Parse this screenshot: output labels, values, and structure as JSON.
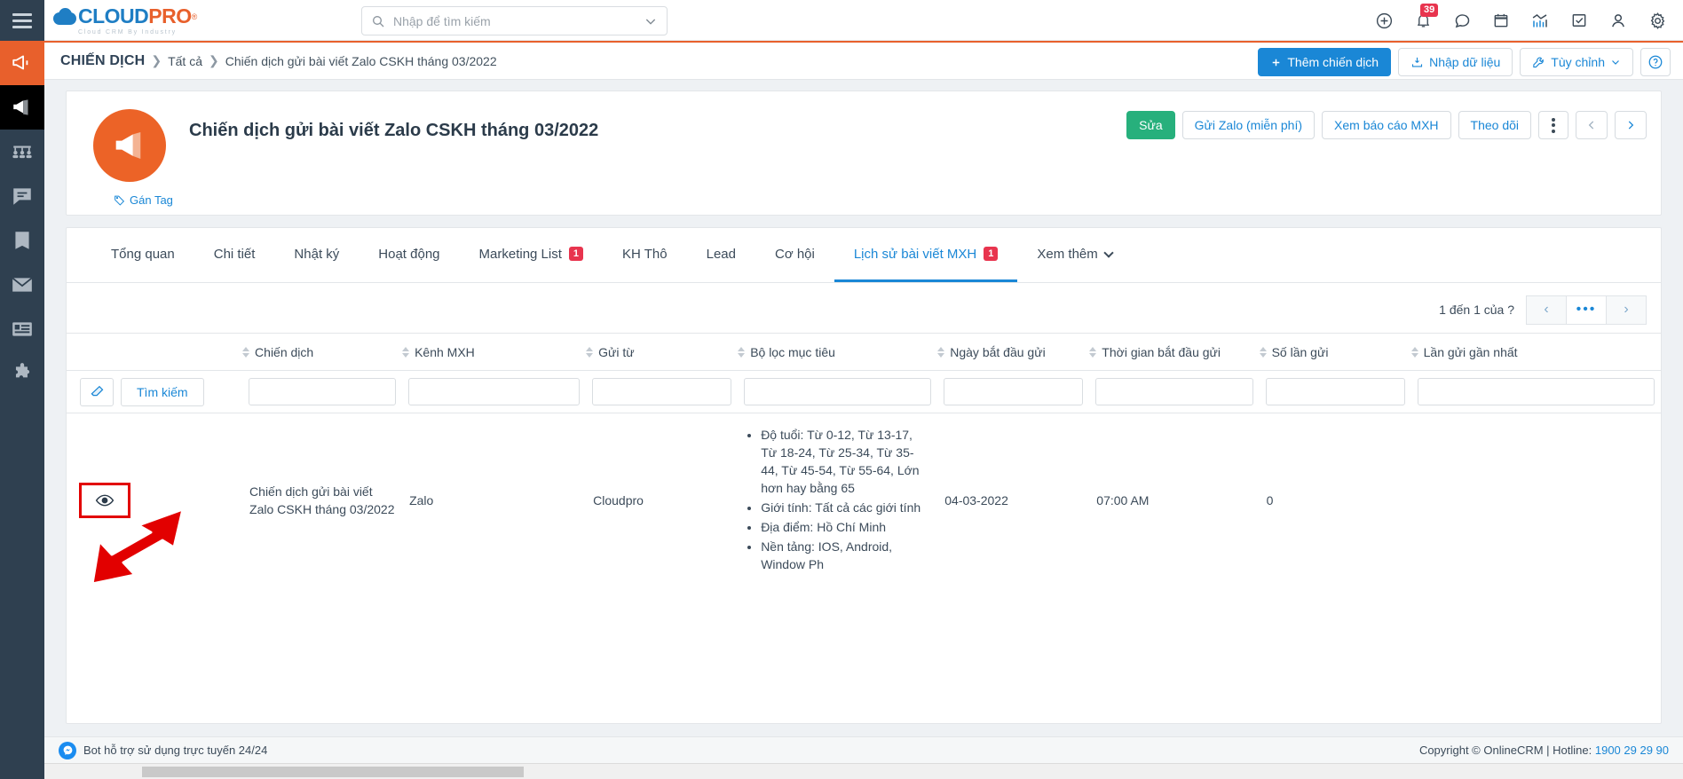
{
  "app": {
    "logo_cloud": "CLOUD",
    "logo_pro": "PRO",
    "logo_reg": "®",
    "logo_tagline": "Cloud CRM By Industry"
  },
  "search": {
    "placeholder": "Nhập để tìm kiếm",
    "value": "",
    "icon": "search-icon",
    "dropdown_icon": "chevron-down-icon"
  },
  "topbar_icons": [
    {
      "name": "add-circle-icon",
      "label": ""
    },
    {
      "name": "bell-icon",
      "label": "",
      "badge": "39"
    },
    {
      "name": "chat-bubble-icon",
      "label": ""
    },
    {
      "name": "calendar-icon",
      "label": ""
    },
    {
      "name": "analytics-chart-icon",
      "label": ""
    },
    {
      "name": "task-checkbox-icon",
      "label": ""
    },
    {
      "name": "user-account-icon",
      "label": ""
    },
    {
      "name": "settings-gear-icon",
      "label": ""
    }
  ],
  "sidebar": {
    "items": [
      {
        "name": "sidebar-item-campaign-active",
        "icon": "megaphone-icon",
        "state": "active"
      },
      {
        "name": "sidebar-item-campaign",
        "icon": "megaphone-icon",
        "state": "dark"
      },
      {
        "name": "sidebar-item-customers",
        "icon": "group-people-icon",
        "state": "normal"
      },
      {
        "name": "sidebar-item-chat",
        "icon": "chat-lines-icon",
        "state": "normal"
      },
      {
        "name": "sidebar-item-library",
        "icon": "book-icon",
        "state": "normal"
      },
      {
        "name": "sidebar-item-mail",
        "icon": "envelope-icon",
        "state": "normal"
      },
      {
        "name": "sidebar-item-news",
        "icon": "newspaper-icon",
        "state": "normal"
      },
      {
        "name": "sidebar-item-addons",
        "icon": "puzzle-piece-icon",
        "state": "normal"
      }
    ]
  },
  "breadcrumb": {
    "root": "CHIẾN DỊCH",
    "sep": "❯",
    "level1": "Tất cả",
    "level2": "Chiến dịch gửi bài viết Zalo CSKH tháng 03/2022"
  },
  "crumb_actions": {
    "add_campaign": "Thêm chiến dịch",
    "import_data": "Nhập dữ liệu",
    "customize": "Tùy chỉnh",
    "help_icon": "question-circle-icon",
    "add_icon": "plus-icon",
    "import_icon": "download-tray-icon",
    "customize_icon": "wrench-icon",
    "customize_caret": "chevron-down-icon"
  },
  "campaign": {
    "avatar_icon": "megaphone-icon",
    "title": "Chiến dịch gửi bài viết Zalo CSKH tháng 03/2022",
    "tag_label": "Gán Tag",
    "tag_icon": "tag-icon",
    "actions": {
      "edit": "Sửa",
      "send_zalo": "Gửi Zalo (miễn phí)",
      "report": "Xem báo cáo MXH",
      "follow": "Theo dõi",
      "more_icon": "vertical-dots-icon",
      "prev_icon": "chevron-left-icon",
      "next_icon": "chevron-right-icon"
    }
  },
  "tabs": [
    {
      "label": "Tổng quan",
      "badge": null,
      "active": false
    },
    {
      "label": "Chi tiết",
      "badge": null,
      "active": false
    },
    {
      "label": "Nhật ký",
      "badge": null,
      "active": false
    },
    {
      "label": "Hoạt động",
      "badge": null,
      "active": false
    },
    {
      "label": "Marketing List",
      "badge": "1",
      "active": false
    },
    {
      "label": "KH Thô",
      "badge": null,
      "active": false
    },
    {
      "label": "Lead",
      "badge": null,
      "active": false
    },
    {
      "label": "Cơ hội",
      "badge": null,
      "active": false
    },
    {
      "label": "Lịch sử bài viết MXH",
      "badge": "1",
      "active": true
    },
    {
      "label": "Xem thêm",
      "badge": null,
      "active": false,
      "caret": true
    }
  ],
  "grid": {
    "pager_label": "1 đến 1 của  ?",
    "pager": {
      "prev": "‹",
      "mid": "•••",
      "next": "›"
    },
    "toolbar": {
      "eraser_icon": "eraser-icon",
      "search_button": "Tìm kiếm"
    },
    "columns": [
      {
        "key": "actions",
        "label": "",
        "sortable": false
      },
      {
        "key": "campaign",
        "label": "Chiến dịch",
        "sortable": true
      },
      {
        "key": "channel",
        "label": "Kênh MXH",
        "sortable": true
      },
      {
        "key": "sent_from",
        "label": "Gửi từ",
        "sortable": true
      },
      {
        "key": "target_filter",
        "label": "Bộ lọc mục tiêu",
        "sortable": true
      },
      {
        "key": "start_date",
        "label": "Ngày bắt đầu gửi",
        "sortable": true
      },
      {
        "key": "start_time",
        "label": "Thời gian bắt đầu gửi",
        "sortable": true
      },
      {
        "key": "send_count",
        "label": "Số lần gửi",
        "sortable": true
      },
      {
        "key": "last_sent",
        "label": "Lần gửi gần nhất",
        "sortable": true
      }
    ],
    "filter_values": {
      "campaign": "",
      "channel": "",
      "sent_from": "",
      "target_filter": "",
      "start_date": "",
      "start_time": "",
      "send_count": "",
      "last_sent": ""
    },
    "rows": [
      {
        "view_icon": "eye-icon",
        "campaign": "Chiến dịch gửi bài viết Zalo CSKH tháng 03/2022",
        "channel": "Zalo",
        "sent_from": "Cloudpro",
        "target_filter": [
          "Độ tuổi: Từ 0-12, Từ 13-17, Từ 18-24, Từ 25-34, Từ 35-44, Từ 45-54, Từ 55-64, Lớn hơn hay bằng 65",
          "Giới tính: Tất cả các giới tính",
          "Địa điểm: Hồ Chí Minh",
          "Nền tảng: IOS, Android, Window Ph"
        ],
        "start_date": "04-03-2022",
        "start_time": "07:00 AM",
        "send_count": "0",
        "last_sent": ""
      }
    ]
  },
  "footer": {
    "bot_text": "Bot hỗ trợ sử dụng trực tuyến 24/24",
    "bot_icon": "messenger-icon",
    "copyright": "Copyright © OnlineCRM | Hotline: ",
    "hotline": "1900 29 29 90"
  },
  "annotation": {
    "arrow_name": "red-pointer-arrow",
    "highlight_name": "red-highlight-box"
  },
  "colors": {
    "brand_blue": "#1a87d6",
    "brand_orange": "#e8602c",
    "green": "#27b07c",
    "badge_red": "#e8344e",
    "annotation_red": "#e20000",
    "sidebar": "#2f4050"
  }
}
